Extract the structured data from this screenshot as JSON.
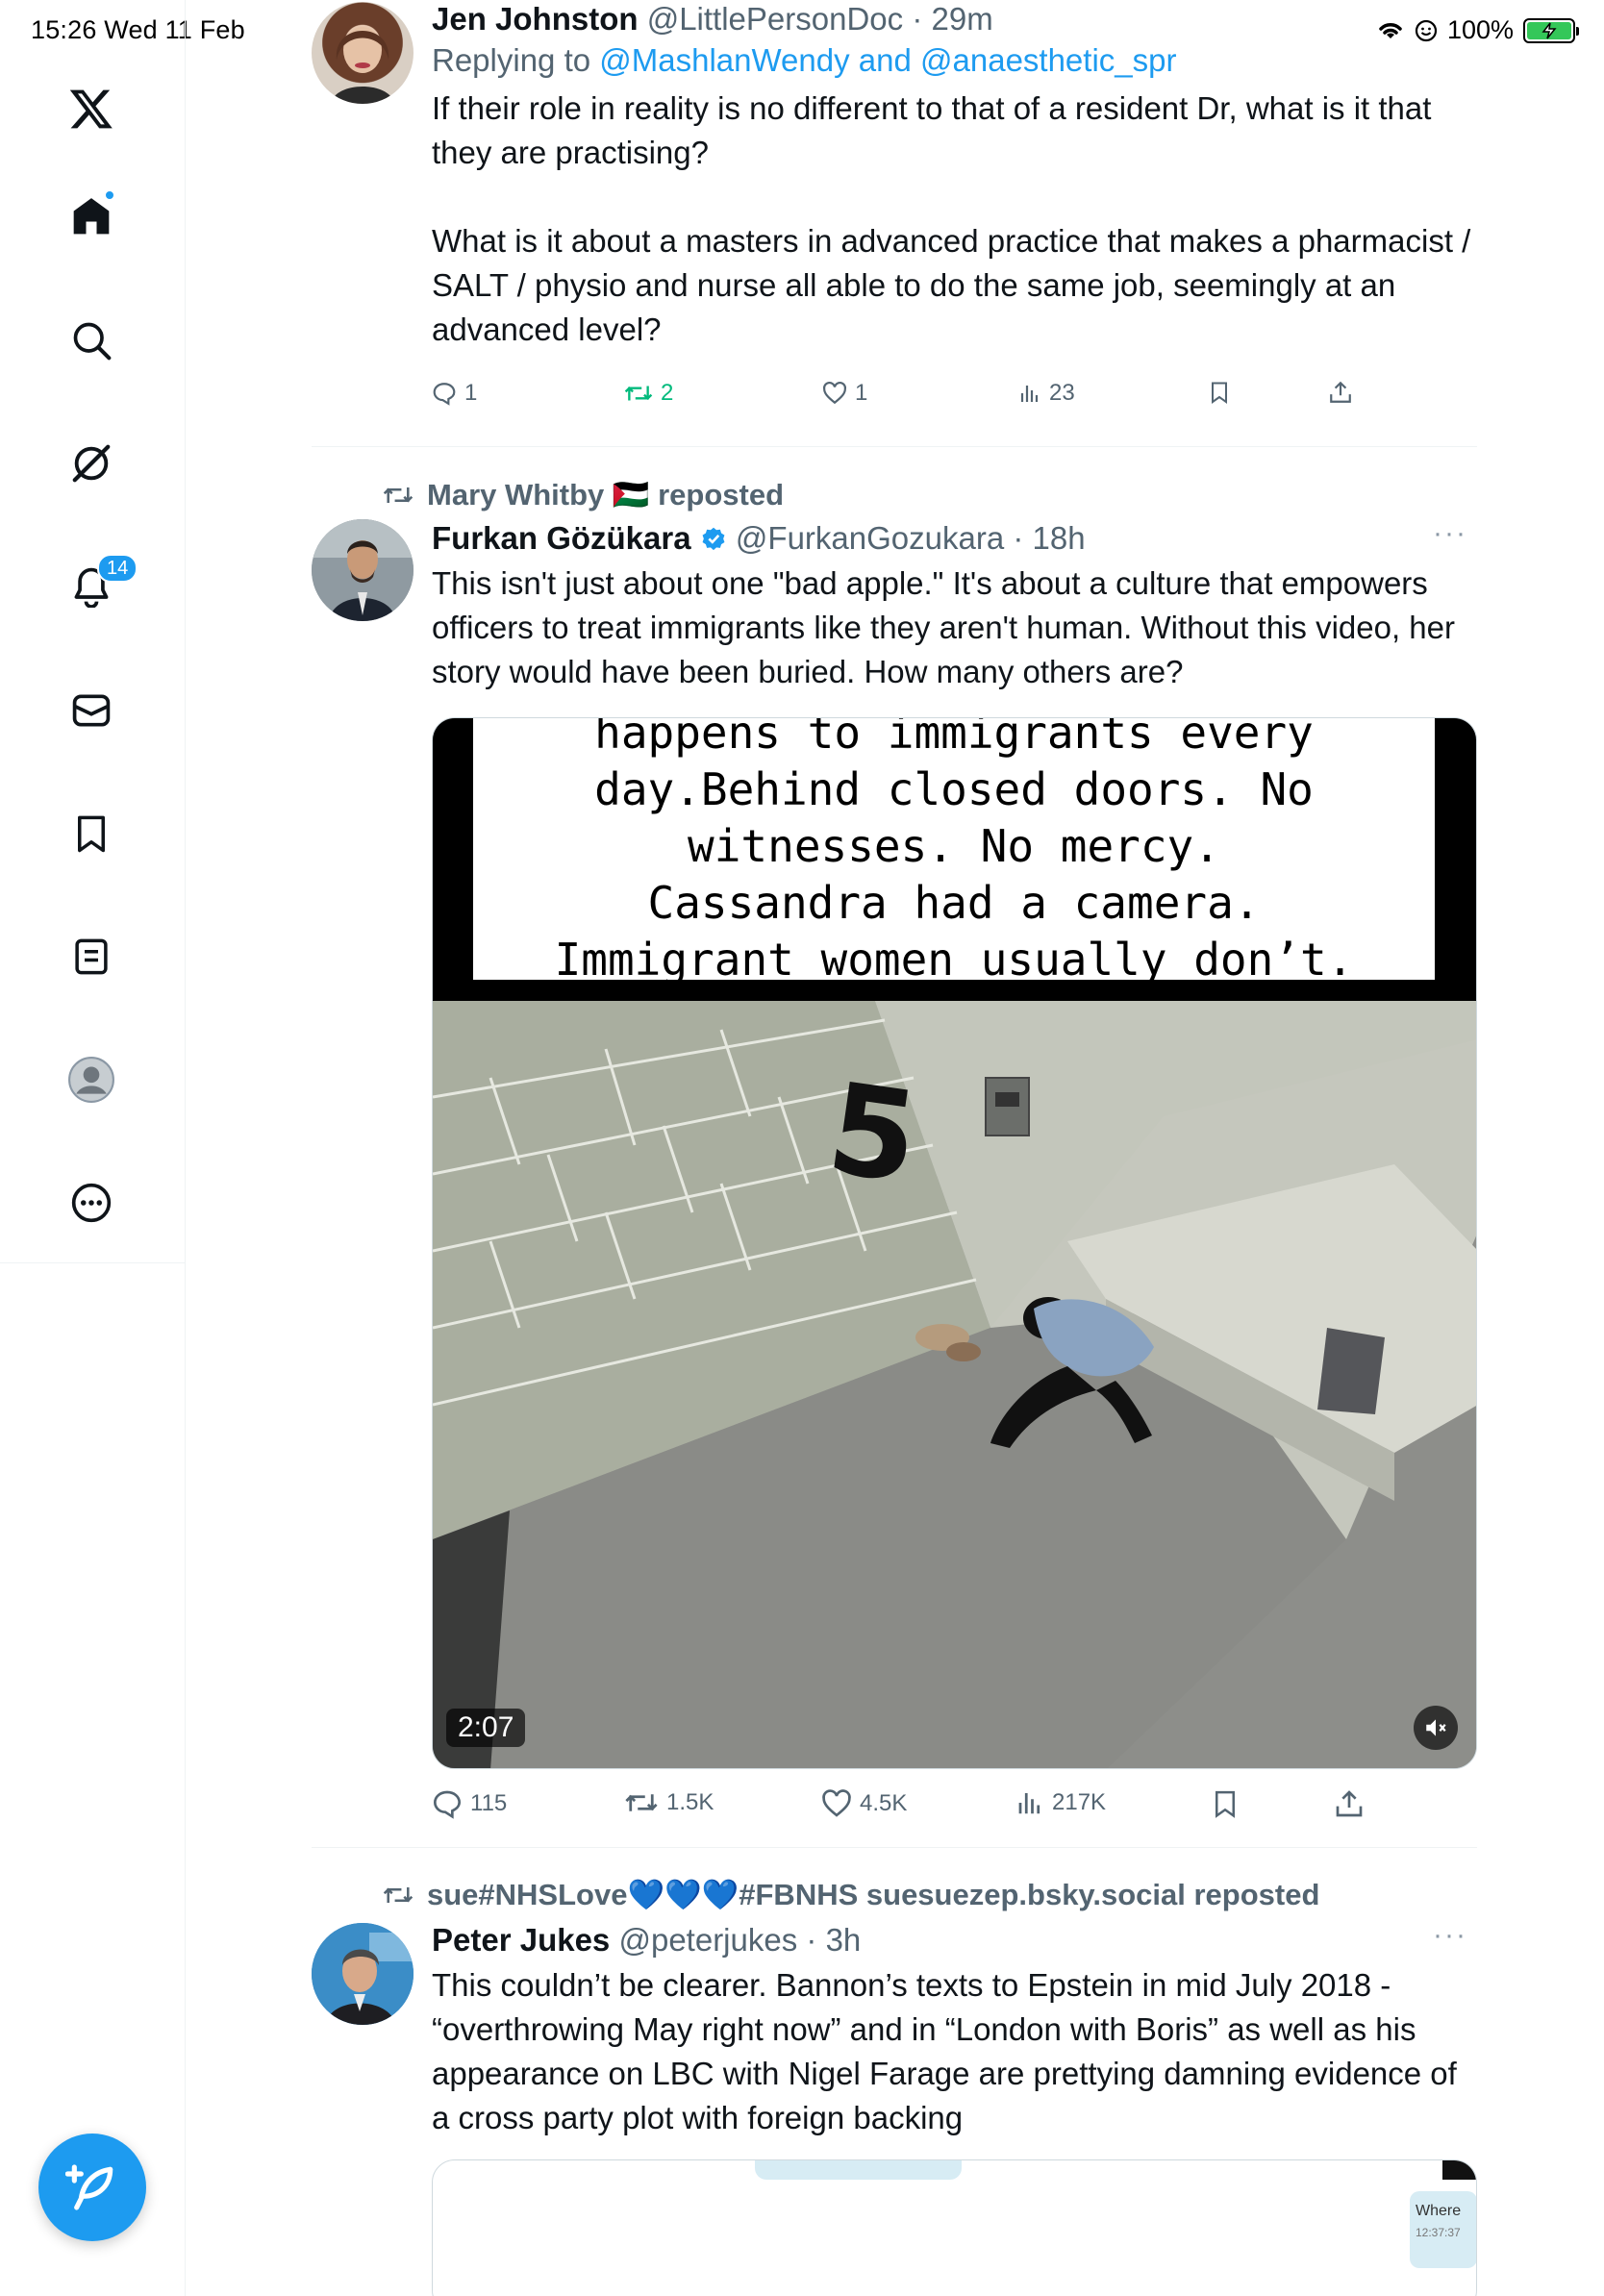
{
  "status_bar": {
    "time_date": "15:26   Wed 11 Feb",
    "battery": "100%"
  },
  "sidebar": {
    "notifications_badge": "14"
  },
  "tweets": [
    {
      "name": "Jen Johnston",
      "handle": "@LittlePersonDoc",
      "time": "29m",
      "reply_prefix": "Replying to ",
      "reply_to": "@MashlanWendy and @anaesthetic_spr",
      "paragraphs": [
        "If their role in reality is no different to that of a resident Dr, what is it that they are practising?",
        "What is it about a masters in advanced practice that makes a pharmacist / SALT / physio and nurse all able to do the same job, seemingly at an advanced level?"
      ],
      "replies": "1",
      "reposts": "2",
      "likes": "1",
      "views": "23"
    },
    {
      "reposted_by": "Mary Whitby 🇵🇸 reposted",
      "name": "Furkan Gözükara",
      "handle": "@FurkanGozukara",
      "time": "18h",
      "text": "This isn't just about one \"bad apple.\" It's about a culture that empowers officers to treat immigrants like they aren't human. Without this video, her story would have been buried. How many others are?",
      "video_caption_lines": [
        "happens to immigrants every",
        "day.Behind closed doors. No",
        "witnesses. No mercy.",
        "Cassandra had a camera.",
        "Immigrant women usually don’t."
      ],
      "video_duration": "2:07",
      "cell_number": "5",
      "replies": "115",
      "reposts": "1.5K",
      "likes": "4.5K",
      "views": "217K"
    },
    {
      "reposted_by": "sue#NHSLove💙💙💙#FBNHS suesuezep.bsky.social reposted",
      "name": "Peter Jukes",
      "handle": "@peterjukes",
      "time": "3h",
      "text": "This couldn’t be clearer. Bannon’s texts to Epstein in mid July 2018 - “overthrowing May right now” and in “London with Boris” as well as his appearance on LBC with Nigel Farage are prettying damning evidence of a cross party plot with foreign backing",
      "card_bubble_text": "Where",
      "card_bubble_time": "12:37:37"
    }
  ],
  "colors": {
    "accent": "#1d9bf0",
    "repost_green": "#00ba7c",
    "muted": "#536471"
  }
}
